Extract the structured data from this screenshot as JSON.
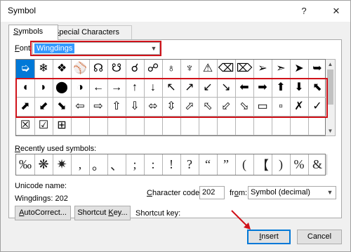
{
  "window": {
    "title": "Symbol",
    "help_button": "?",
    "close_button": "✕"
  },
  "tabs": [
    {
      "label_pre": "",
      "label_u": "S",
      "label_post": "ymbols",
      "active": true
    },
    {
      "label_pre": "",
      "label_u": "S",
      "label_post": "pecial Characters",
      "active": false
    }
  ],
  "font": {
    "label_u": "F",
    "label_post": "ont:",
    "value": "Wingdings"
  },
  "grid": {
    "rows": [
      [
        "➭",
        "❄",
        "❖",
        "⚾",
        "☊",
        "☋",
        "☌",
        "☍",
        "♁",
        "♆",
        "⚠",
        "⌫",
        "⌦",
        "➢",
        "➣",
        "➤",
        "➥"
      ],
      [
        "◖",
        "◗",
        "⬤",
        "◑",
        "←",
        "→",
        "↑",
        "↓",
        "↖",
        "↗",
        "↙",
        "↘",
        "⬅",
        "➡",
        "⬆",
        "⬇",
        "⬉"
      ],
      [
        "⬈",
        "⬋",
        "⬊",
        "⇦",
        "⇨",
        "⇧",
        "⇩",
        "⬄",
        "⇳",
        "⬀",
        "⬁",
        "⬃",
        "⬂",
        "▭",
        "▫",
        "✗",
        "✓"
      ],
      [
        "☒",
        "☑",
        "⊞",
        "",
        "",
        "",
        "",
        "",
        "",
        "",
        "",
        "",
        "",
        "",
        "",
        "",
        ""
      ]
    ]
  },
  "recent": {
    "label_u": "R",
    "label_post": "ecently used symbols:",
    "symbols": [
      "‰",
      "❋",
      "✷",
      ",",
      "。",
      "、",
      ";",
      ":",
      "!",
      "?",
      "“",
      "”",
      "(",
      "【",
      ")",
      "%",
      "&"
    ]
  },
  "unicode_name": {
    "label": "Unicode name:",
    "value": "Wingdings: 202"
  },
  "char_code": {
    "label_u": "C",
    "label_pre": "",
    "label_post": "haracter code:",
    "value": "202"
  },
  "from": {
    "label_pre": "fr",
    "label_u": "o",
    "label_post": "m:",
    "value": "Symbol (decimal)"
  },
  "buttons": {
    "autocorrect": {
      "pre": "",
      "u": "A",
      "post": "utoCorrect..."
    },
    "shortcut_key": {
      "pre": "Shortcut ",
      "u": "K",
      "post": "ey..."
    },
    "shortcut_key_label": "Shortcut key:",
    "insert": {
      "pre": "",
      "u": "I",
      "post": "nsert"
    },
    "cancel": "Cancel"
  },
  "colors": {
    "highlight": "#d0121a",
    "selection": "#0078d7"
  }
}
